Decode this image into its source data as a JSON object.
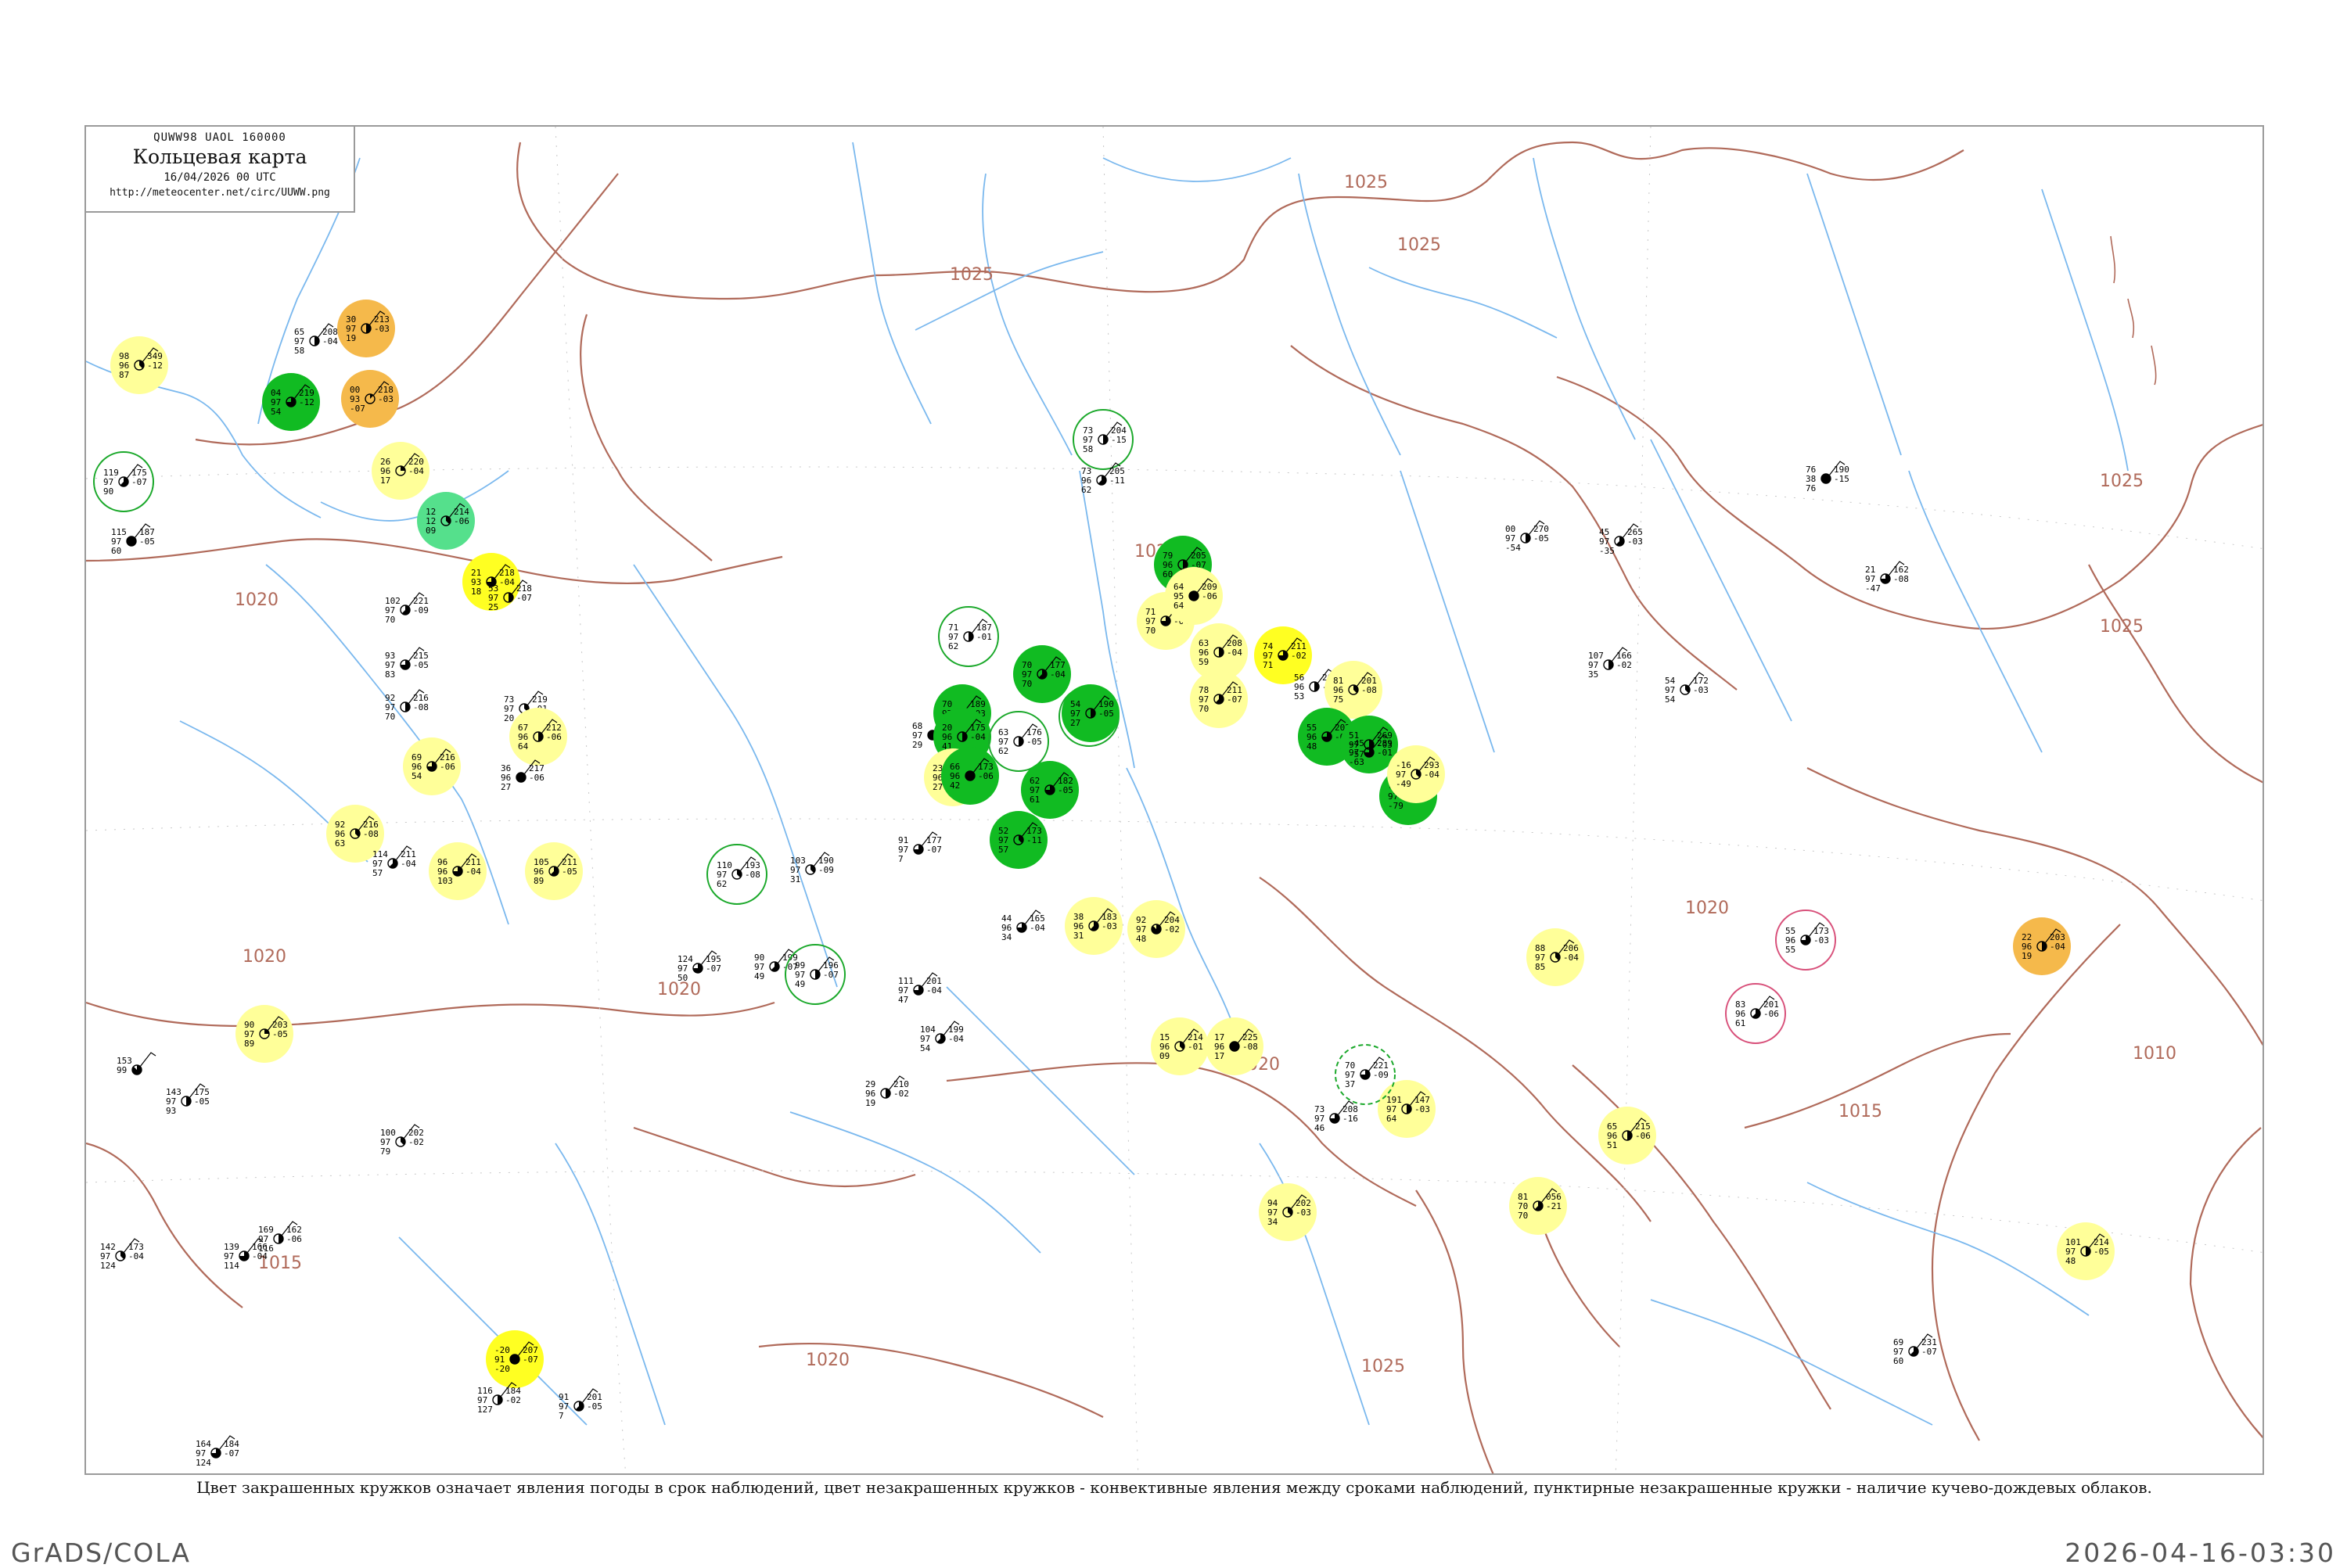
{
  "header": {
    "code_line": "QUWW98  UAOL  160000",
    "title": "Кольцевая карта",
    "date": "16/04/2026 00 UTC",
    "url": "http://meteocenter.net/circ/UUWW.png"
  },
  "caption": "Цвет закрашенных кружков означает явления погоды в срок наблюдений, цвет незакрашенных кружков - конвективные явления между сроками наблюдений, пунктирные незакрашенные кружки - наличие кучево-дождевых облаков.",
  "footer": {
    "left": "GrADS/COLA",
    "right": "2026-04-16-03:30"
  },
  "colors": {
    "green": "#11bb22",
    "yellow": "#ffff22",
    "light_yellow": "#ffff99",
    "orange": "#f5b94b",
    "teal": "#55e08c",
    "isobar": "#b06a5a",
    "river": "#77b8ee",
    "ring_green": "#1aa82a",
    "ring_red": "#d8507a"
  },
  "isobar_labels": [
    "1025",
    "1025",
    "1025",
    "1025",
    "1020",
    "1020",
    "1020",
    "1020",
    "1020",
    "1020",
    "1020",
    "1025",
    "1015",
    "1015",
    "1010",
    "1025"
  ],
  "stations": [
    {
      "t": "98",
      "p": "349",
      "w": "96",
      "pt": "-12",
      "d": "87",
      "c": "3"
    },
    {
      "t": "30",
      "p": "213",
      "w": "97",
      "pt": "-03",
      "d": "19",
      "c": "4"
    },
    {
      "t": "04",
      "p": "219",
      "w": "97",
      "pt": "-12",
      "d": "54",
      "c": "6"
    },
    {
      "t": "65",
      "p": "208",
      "w": "97",
      "pt": "-04",
      "d": "58",
      "c": "4"
    },
    {
      "t": "00",
      "p": "218",
      "w": "93",
      "pt": "-03",
      "d": "-07",
      "c": "1"
    },
    {
      "t": "26",
      "p": "220",
      "w": "96",
      "pt": "-04",
      "d": "17",
      "c": "2"
    },
    {
      "t": "119",
      "p": "175",
      "w": "97",
      "pt": "-07",
      "d": "90",
      "c": "5"
    },
    {
      "t": "115",
      "p": "187",
      "w": "97",
      "pt": "-05",
      "d": "60",
      "c": "8"
    },
    {
      "t": "12",
      "p": "214",
      "w": "12",
      "pt": "-06",
      "d": "09",
      "c": "3"
    },
    {
      "t": "21",
      "p": "218",
      "w": "93",
      "pt": "-04",
      "d": "18",
      "c": "6"
    },
    {
      "t": "53",
      "p": "218",
      "w": "97",
      "pt": "-07",
      "d": "25",
      "c": "4"
    },
    {
      "t": "102",
      "p": "221",
      "w": "97",
      "pt": "-09",
      "d": "70",
      "c": "5"
    },
    {
      "t": "93",
      "p": "215",
      "w": "97",
      "pt": "-05",
      "d": "83",
      "c": "6"
    },
    {
      "t": "92",
      "p": "216",
      "w": "97",
      "pt": "-08",
      "d": "70",
      "c": "4"
    },
    {
      "t": "73",
      "p": "219",
      "w": "97",
      "pt": "-01",
      "d": "20",
      "c": "3"
    },
    {
      "t": "91",
      "p": "215",
      "w": "97",
      "pt": "-08",
      "d": "64",
      "c": "7"
    },
    {
      "t": "69",
      "p": "216",
      "w": "96",
      "pt": "-06",
      "d": "54",
      "c": "6"
    },
    {
      "t": "67",
      "p": "212",
      "w": "96",
      "pt": "-06",
      "d": "64",
      "c": "4"
    },
    {
      "t": "36",
      "p": "217",
      "w": "96",
      "pt": "-06",
      "d": "27",
      "c": "8"
    },
    {
      "t": "92",
      "p": "216",
      "w": "96",
      "pt": "-08",
      "d": "63",
      "c": "3"
    },
    {
      "t": "114",
      "p": "211",
      "w": "97",
      "pt": "-04",
      "d": "57",
      "c": "5"
    },
    {
      "t": "96",
      "p": "211",
      "w": "96",
      "pt": "-04",
      "d": "103",
      "c": "6"
    },
    {
      "t": "105",
      "p": "211",
      "w": "96",
      "pt": "-05",
      "d": "89",
      "c": "5"
    },
    {
      "t": "90",
      "p": "203",
      "w": "97",
      "pt": "-05",
      "d": "89",
      "c": "2"
    },
    {
      "t": "153",
      "p": "",
      "w": "99",
      "pt": "",
      "d": "",
      "c": "7"
    },
    {
      "t": "143",
      "p": "175",
      "w": "97",
      "pt": "-05",
      "d": "93",
      "c": "4"
    },
    {
      "t": "100",
      "p": "202",
      "w": "97",
      "pt": "-02",
      "d": "79",
      "c": "3"
    },
    {
      "t": "169",
      "p": "162",
      "w": "97",
      "pt": "-06",
      "d": "116",
      "c": "4"
    },
    {
      "t": "142",
      "p": "173",
      "w": "97",
      "pt": "-04",
      "d": "124",
      "c": "3"
    },
    {
      "t": "139",
      "p": "166",
      "w": "97",
      "pt": "-04",
      "d": "114",
      "c": "6"
    },
    {
      "t": "-20",
      "p": "207",
      "w": "91",
      "pt": "-07",
      "d": "-20",
      "c": "8"
    },
    {
      "t": "116",
      "p": "184",
      "w": "97",
      "pt": "-02",
      "d": "127",
      "c": "4"
    },
    {
      "t": "91",
      "p": "201",
      "w": "97",
      "pt": "-05",
      "d": "7",
      "c": "5"
    },
    {
      "t": "164",
      "p": "184",
      "w": "97",
      "pt": "-07",
      "d": "124",
      "c": "6"
    },
    {
      "t": "110",
      "p": "193",
      "w": "97",
      "pt": "-08",
      "d": "62",
      "c": "3"
    },
    {
      "t": "124",
      "p": "195",
      "w": "97",
      "pt": "-07",
      "d": "50",
      "c": "6"
    },
    {
      "t": "90",
      "p": "199",
      "w": "97",
      "pt": "-07",
      "d": "49",
      "c": "5"
    },
    {
      "t": "99",
      "p": "196",
      "w": "97",
      "pt": "-07",
      "d": "49",
      "c": "4"
    },
    {
      "t": "103",
      "p": "190",
      "w": "97",
      "pt": "-09",
      "d": "31",
      "c": "3"
    },
    {
      "t": "91",
      "p": "177",
      "w": "97",
      "pt": "-07",
      "d": "7",
      "c": "6"
    },
    {
      "t": "68",
      "p": "182",
      "w": "97",
      "pt": "-03",
      "d": "29",
      "c": "8"
    },
    {
      "t": "71",
      "p": "187",
      "w": "97",
      "pt": "-01",
      "d": "62",
      "c": "4"
    },
    {
      "t": "70",
      "p": "189",
      "w": "97",
      "pt": "-03",
      "d": "66",
      "c": "7"
    },
    {
      "t": "20",
      "p": "175",
      "w": "96",
      "pt": "-04",
      "d": "41",
      "c": "4"
    },
    {
      "t": "23",
      "p": "178",
      "w": "96",
      "pt": "-06",
      "d": "27",
      "c": "6"
    },
    {
      "t": "66",
      "p": "173",
      "w": "96",
      "pt": "-06",
      "d": "42",
      "c": "8"
    },
    {
      "t": "70",
      "p": "177",
      "w": "97",
      "pt": "-04",
      "d": "70",
      "c": "5"
    },
    {
      "t": "63",
      "p": "176",
      "w": "97",
      "pt": "-05",
      "d": "62",
      "c": "4"
    },
    {
      "t": "62",
      "p": "182",
      "w": "97",
      "pt": "-05",
      "d": "61",
      "c": "6"
    },
    {
      "t": "52",
      "p": "173",
      "w": "97",
      "pt": "-11",
      "d": "57",
      "c": "3"
    },
    {
      "t": "20",
      "p": "180",
      "w": "96",
      "pt": "-07",
      "d": "41",
      "c": "2"
    },
    {
      "t": "54",
      "p": "190",
      "w": "97",
      "pt": "-05",
      "d": "27",
      "c": "4"
    },
    {
      "t": "44",
      "p": "165",
      "w": "96",
      "pt": "-04",
      "d": "34",
      "c": "6"
    },
    {
      "t": "38",
      "p": "183",
      "w": "96",
      "pt": "-03",
      "d": "31",
      "c": "5"
    },
    {
      "t": "92",
      "p": "204",
      "w": "97",
      "pt": "-02",
      "d": "48",
      "c": "7"
    },
    {
      "t": "111",
      "p": "201",
      "w": "97",
      "pt": "-04",
      "d": "47",
      "c": "6"
    },
    {
      "t": "104",
      "p": "199",
      "w": "97",
      "pt": "-04",
      "d": "54",
      "c": "5"
    },
    {
      "t": "29",
      "p": "210",
      "w": "96",
      "pt": "-02",
      "d": "19",
      "c": "4"
    },
    {
      "t": "15",
      "p": "214",
      "w": "96",
      "pt": "-01",
      "d": "09",
      "c": "3"
    },
    {
      "t": "17",
      "p": "225",
      "w": "96",
      "pt": "-08",
      "d": "17",
      "c": "8"
    },
    {
      "t": "73",
      "p": "208",
      "w": "97",
      "pt": "-16",
      "d": "46",
      "c": "6"
    },
    {
      "t": "73",
      "p": "204",
      "w": "97",
      "pt": "-15",
      "d": "58",
      "c": "4"
    },
    {
      "t": "73",
      "p": "205",
      "w": "96",
      "pt": "-11",
      "d": "62",
      "c": "5"
    },
    {
      "t": "79",
      "p": "205",
      "w": "96",
      "pt": "-07",
      "d": "60",
      "c": "4"
    },
    {
      "t": "71",
      "p": "207",
      "w": "97",
      "pt": "-04",
      "d": "70",
      "c": "6"
    },
    {
      "t": "64",
      "p": "209",
      "w": "95",
      "pt": "-06",
      "d": "64",
      "c": "8"
    },
    {
      "t": "63",
      "p": "208",
      "w": "96",
      "pt": "-04",
      "d": "59",
      "c": "4"
    },
    {
      "t": "74",
      "p": "211",
      "w": "97",
      "pt": "-02",
      "d": "71",
      "c": "6"
    },
    {
      "t": "78",
      "p": "211",
      "w": "97",
      "pt": "-07",
      "d": "70",
      "c": "5"
    },
    {
      "t": "56",
      "p": "208",
      "w": "96",
      "pt": "-07",
      "d": "53",
      "c": "4"
    },
    {
      "t": "81",
      "p": "201",
      "w": "96",
      "pt": "-08",
      "d": "75",
      "c": "3"
    },
    {
      "t": "55",
      "p": "202",
      "w": "96",
      "pt": "-05",
      "d": "48",
      "c": "6"
    },
    {
      "t": "51",
      "p": "269",
      "w": "97",
      "pt": "-03",
      "d": "-57",
      "c": "4"
    },
    {
      "t": "-51",
      "p": "268",
      "w": "97",
      "pt": "-07",
      "d": "-79",
      "c": "5"
    },
    {
      "t": "-45",
      "p": "289",
      "w": "97",
      "pt": "-01",
      "d": "-63",
      "c": "6"
    },
    {
      "t": "-16",
      "p": "293",
      "w": "97",
      "pt": "-04",
      "d": "-49",
      "c": "3"
    },
    {
      "t": "00",
      "p": "270",
      "w": "97",
      "pt": "-05",
      "d": "-54",
      "c": "4"
    },
    {
      "t": "45",
      "p": "265",
      "w": "97",
      "pt": "-03",
      "d": "-35",
      "c": "5"
    },
    {
      "t": "76",
      "p": "190",
      "w": "38",
      "pt": "-15",
      "d": "76",
      "c": "8"
    },
    {
      "t": "21",
      "p": "162",
      "w": "97",
      "pt": "-08",
      "d": "-47",
      "c": "6"
    },
    {
      "t": "107",
      "p": "166",
      "w": "97",
      "pt": "-02",
      "d": "35",
      "c": "4"
    },
    {
      "t": "54",
      "p": "172",
      "w": "97",
      "pt": "-03",
      "d": "54",
      "c": "3"
    },
    {
      "t": "55",
      "p": "173",
      "w": "96",
      "pt": "-03",
      "d": "55",
      "c": "6"
    },
    {
      "t": "22",
      "p": "203",
      "w": "96",
      "pt": "-04",
      "d": "19",
      "c": "4"
    },
    {
      "t": "83",
      "p": "201",
      "w": "96",
      "pt": "-06",
      "d": "61",
      "c": "5"
    },
    {
      "t": "88",
      "p": "206",
      "w": "97",
      "pt": "-04",
      "d": "85",
      "c": "3"
    },
    {
      "t": "65",
      "p": "215",
      "w": "96",
      "pt": "-06",
      "d": "51",
      "c": "4"
    },
    {
      "t": "81",
      "p": "056",
      "w": "70",
      "pt": "-21",
      "d": "70",
      "c": "5"
    },
    {
      "t": "191",
      "p": "147",
      "w": "97",
      "pt": "-03",
      "d": "64",
      "c": "4"
    },
    {
      "t": "70",
      "p": "221",
      "w": "97",
      "pt": "-09",
      "d": "37",
      "c": "6"
    },
    {
      "t": "94",
      "p": "202",
      "w": "97",
      "pt": "-03",
      "d": "34",
      "c": "3"
    },
    {
      "t": "101",
      "p": "214",
      "w": "97",
      "pt": "-05",
      "d": "48",
      "c": "4"
    },
    {
      "t": "69",
      "p": "231",
      "w": "97",
      "pt": "-07",
      "d": "60",
      "c": "5"
    }
  ]
}
